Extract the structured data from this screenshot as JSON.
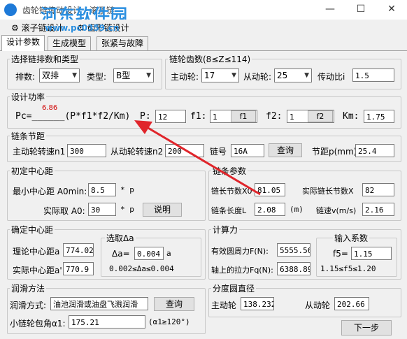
{
  "window": {
    "title": "齿轮链传动设计 - 滚子链",
    "minimize": "—",
    "maximize": "☐",
    "close": "✕"
  },
  "watermark": {
    "brand": "河东软件园",
    "url": "www.pc0359.cn"
  },
  "menu": {
    "items": [
      "滚子链设计",
      "齿形链设计"
    ]
  },
  "tabs": [
    {
      "label": "设计参数"
    },
    {
      "label": "生成模型"
    },
    {
      "label": "张紧与故障"
    }
  ],
  "chain_type": {
    "title": "选择链排数和类型",
    "rows_label": "排数:",
    "rows_value": "双排",
    "type_label": "类型:",
    "type_value": "B型"
  },
  "teeth": {
    "title": "链轮齿数(8≤Z≤114)",
    "driver_label": "主动轮:",
    "driver_value": "17",
    "driven_label": "从动轮:",
    "driven_value": "25",
    "ratio_label": "传动比i",
    "ratio_value": "1.5"
  },
  "power": {
    "title": "设计功率",
    "pc_label": "Pc=______(P*f1*f2/Km)",
    "pc_value": "6.86",
    "p_label": "P:",
    "p_value": "12",
    "f1_label": "f1:",
    "f1_value": "1",
    "f1_button": "f1",
    "f2_label": "f2:",
    "f2_value": "1",
    "f2_button": "f2",
    "km_label": "Km:",
    "km_value": "1.75"
  },
  "pitch": {
    "title": "链条节距",
    "n1_label": "主动轮转速n1",
    "n1_value": "300",
    "n2_label": "从动轮转速n2",
    "n2_value": "200",
    "chain_no_label": "链号",
    "chain_no_value": "16A",
    "query_button": "查询",
    "p_label": "节距p(mm)",
    "p_value": "25.4"
  },
  "center_initial": {
    "title": "初定中心距",
    "min_label": "最小中心距 A0min:",
    "min_value": "8.5",
    "min_unit": "* p",
    "actual_label": "实际取 A0:",
    "actual_value": "30",
    "actual_unit": "* p",
    "explain_button": "说明"
  },
  "chain_params": {
    "title": "链条参数",
    "links_label": "链长节数X0",
    "links_value": "81.05",
    "actual_links_label": "实际链长节数X",
    "actual_links_value": "82",
    "length_label": "链条长度L",
    "length_value": "2.08",
    "length_unit": "(m)",
    "speed_label": "链速v(m/s)",
    "speed_value": "2.16"
  },
  "center_final": {
    "title": "确定中心距",
    "theory_label": "理论中心距a",
    "theory_value": "774.02",
    "actual_label": "实际中心距a'",
    "actual_value": "770.9",
    "delta_title": "选取Δa",
    "delta_label": "Δa=",
    "delta_value": "0.004",
    "delta_unit": "a",
    "delta_range": "0.002≤Δa≤0.004"
  },
  "calc": {
    "title": "计算力",
    "force_label": "有效圆周力F(N):",
    "force_value": "5555.56",
    "shaft_label": "轴上的拉力Fq(N):",
    "shaft_value": "6388.89",
    "coef_title": "输入系数",
    "f5_label": "f5=",
    "f5_value": "1.15",
    "f5_range": "1.15≤f5≤1.20"
  },
  "lubrication": {
    "title": "润滑方法",
    "method_label": "润滑方式:",
    "method_value": "油池润滑或油盘飞溅润滑",
    "query_button": "查询",
    "wrap_label": "小链轮包角α1:",
    "wrap_value": "175.21",
    "wrap_range": "(α1≥120°)"
  },
  "pitch_circle": {
    "title": "分度圆直径",
    "driver_label": "主动轮",
    "driver_value": "138.232",
    "driven_label": "从动轮",
    "driven_value": "202.66"
  },
  "next_button": "下一步",
  "colors": {
    "accent_red": "#e0252b",
    "pc_value": "#d00000",
    "watermark": "#2b8fe0"
  }
}
